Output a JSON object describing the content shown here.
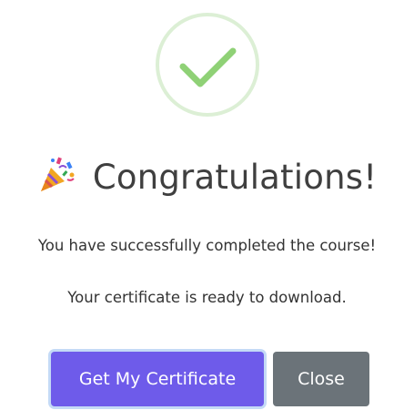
{
  "dialog": {
    "status_icon": "check-circle-icon",
    "celebration_icon": "party-popper-icon",
    "title": "Congratulations!",
    "message_line_1": "You have successfully completed the course!",
    "message_line_2": "Your certificate is ready to download.",
    "primary_button_label": "Get My Certificate",
    "secondary_button_label": "Close"
  },
  "colors": {
    "check_circle_border": "#dcefd5",
    "check_mark": "#8fd176",
    "title_text": "#3f3f3f",
    "primary_button": "#6e5bea",
    "primary_button_focus_ring": "#c4daf6",
    "secondary_button": "#6b7379"
  }
}
